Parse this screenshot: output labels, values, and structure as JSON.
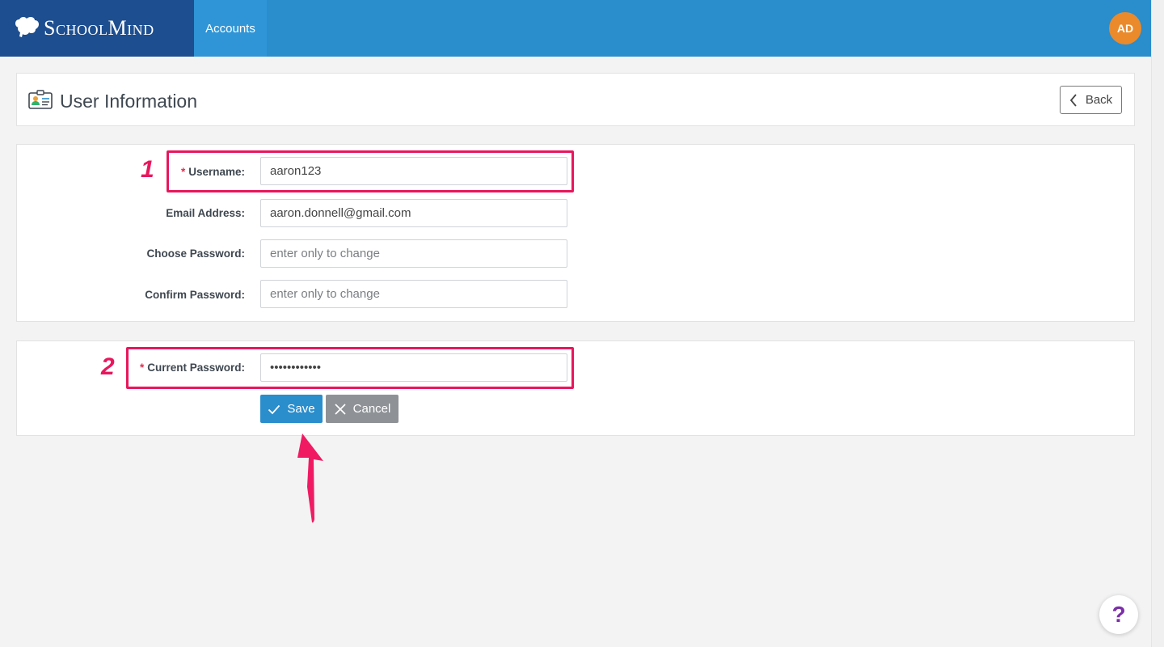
{
  "app": {
    "brand": "SchoolMind",
    "nav_accounts": "Accounts",
    "avatar_initials": "AD",
    "colors": {
      "topbar": "#2a8dcc",
      "brand_bg": "#1d4e8f",
      "avatar": "#ea8a2b",
      "annotation": "#e8175d"
    }
  },
  "header": {
    "title": "User Information",
    "back_label": "Back"
  },
  "form": {
    "username": {
      "label": "Username:",
      "required": "*",
      "value": "aaron123"
    },
    "email": {
      "label": "Email Address:",
      "value": "aaron.donnell@gmail.com"
    },
    "choose_password": {
      "label": "Choose Password:",
      "placeholder": "enter only to change"
    },
    "confirm_password": {
      "label": "Confirm Password:",
      "placeholder": "enter only to change"
    }
  },
  "password_panel": {
    "current_password": {
      "label": "Current Password:",
      "required": "*",
      "value": "••••••••••••"
    },
    "save_label": "Save",
    "cancel_label": "Cancel"
  },
  "annotations": {
    "step1": "1",
    "step2": "2"
  },
  "help": {
    "label": "?"
  }
}
